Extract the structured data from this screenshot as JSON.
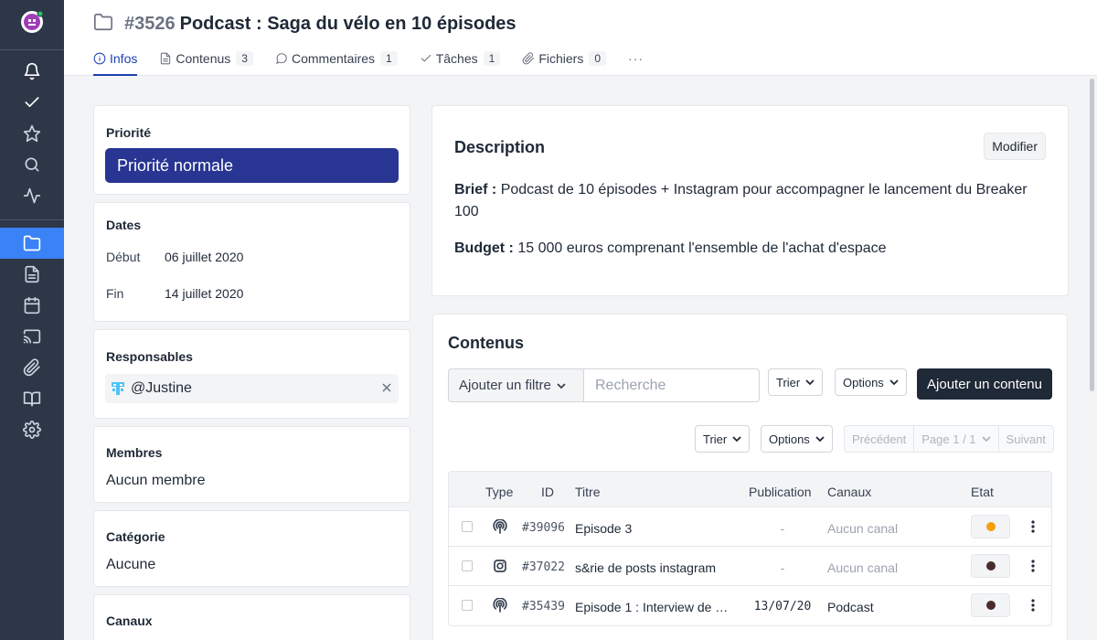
{
  "rail": {
    "items": [
      "bell-icon",
      "check-icon",
      "star-icon",
      "search-icon",
      "activity-icon",
      "folder-icon",
      "document-icon",
      "calendar-icon",
      "cast-icon",
      "paperclip-icon",
      "book-icon",
      "settings-icon"
    ],
    "active": "folder-icon",
    "colors": {
      "background": "#2d3748",
      "active": "#3b82f6"
    }
  },
  "header": {
    "id": "#3526",
    "title": "Podcast : Saga du vélo en 10 épisodes",
    "tabs": [
      {
        "label": "Infos",
        "icon": "info-icon",
        "active": true
      },
      {
        "label": "Contenus",
        "icon": "document-icon",
        "count": "3"
      },
      {
        "label": "Commentaires",
        "icon": "comment-icon",
        "count": "1"
      },
      {
        "label": "Tâches",
        "icon": "check-icon",
        "count": "1"
      },
      {
        "label": "Fichiers",
        "icon": "paperclip-icon",
        "count": "0"
      }
    ],
    "more": "···"
  },
  "sidebar": {
    "priority": {
      "label": "Priorité",
      "value": "Priorité normale",
      "color": "#283593"
    },
    "dates": {
      "label": "Dates",
      "start_label": "Début",
      "start": "06 juillet 2020",
      "end_label": "Fin",
      "end": "14 juillet 2020"
    },
    "owners": {
      "label": "Responsables",
      "name": "@Justine"
    },
    "members": {
      "label": "Membres",
      "value": "Aucun membre"
    },
    "category": {
      "label": "Catégorie",
      "value": "Aucune"
    },
    "channels": {
      "label": "Canaux"
    }
  },
  "description": {
    "title": "Description",
    "edit_label": "Modifier",
    "brief_label": "Brief :",
    "brief": "Podcast de 10 épisodes + Instagram pour accompagner le lancement du Breaker 100",
    "budget_label": "Budget :",
    "budget": "15 000 euros comprenant l'ensemble de l'achat d'espace"
  },
  "contents": {
    "title": "Contenus",
    "filter_label": "Ajouter un filtre",
    "search_placeholder": "Recherche",
    "sort_label": "Trier",
    "options_label": "Options",
    "add_label": "Ajouter un contenu",
    "pager": {
      "prev": "Précédent",
      "page": "Page 1 / 1",
      "next": "Suivant"
    },
    "columns": {
      "type": "Type",
      "id": "ID",
      "title": "Titre",
      "publication": "Publication",
      "channels": "Canaux",
      "state": "Etat"
    },
    "rows": [
      {
        "type_icon": "podcast-icon",
        "id": "#39096",
        "title": "Episode 3",
        "publication": "-",
        "channels": "Aucun canal",
        "state_color": "#f59e0b"
      },
      {
        "type_icon": "instagram-icon",
        "id": "#37022",
        "title": "s&rie de posts instagram",
        "publication": "-",
        "channels": "Aucun canal",
        "state_color": "#4a2c2a"
      },
      {
        "type_icon": "podcast-icon",
        "id": "#35439",
        "title": "Episode 1 : Interview de …",
        "publication": "13/07/20",
        "channels": "Podcast",
        "state_color": "#4a2c2a"
      }
    ]
  }
}
